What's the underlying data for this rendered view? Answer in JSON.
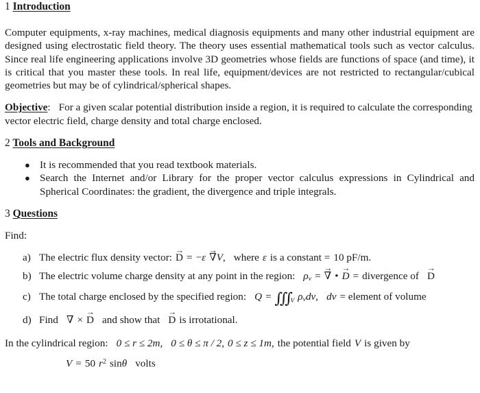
{
  "document": {
    "sections": [
      {
        "number": "1",
        "title": "Introduction"
      },
      {
        "number": "2",
        "title": "Tools and Background"
      },
      {
        "number": "3",
        "title": "Questions"
      }
    ],
    "intro_paragraph": "Computer equipments, x-ray machines, medical diagnosis equipments and many other industrial equipment are designed using electrostatic field theory.  The theory uses essential mathematical tools such as vector calculus.    Since real life engineering applications involve 3D geometries whose fields are functions of space (and time), it is critical that you master these tools.  In real life, equipment/devices are not restricted to rectangular/cubical geometries but may be of cylindrical/spherical shapes.",
    "objective": {
      "label": "Objective",
      "separator": ":",
      "text": "For a given scalar potential distribution inside a region, it is required to calculate the corresponding vector electric field, charge density and total charge enclosed."
    },
    "tools_bullets": [
      "It is recommended that you read textbook materials.",
      "Search the Internet and/or Library for the proper vector calculus expressions in Cylindrical and Spherical Coordinates: the gradient, the divergence and triple integrals."
    ],
    "find_label": "Find:",
    "questions": [
      {
        "marker": "a)",
        "lead": "The electric flux density vector:",
        "vector_symbol": "D",
        "equals": "=",
        "minus": "−",
        "epsilon": "ε",
        "nabla": "∇",
        "potential_symbol": "V",
        "comma": ",",
        "tail_pre": "where",
        "tail_mid": "is a constant =",
        "tail_value": "10 pF/m."
      },
      {
        "marker": "b)",
        "lead": "The electric volume charge density at any point in the region:",
        "rho": "ρ",
        "rho_sub": "v",
        "equals": "=",
        "nabla": "∇",
        "dot": "•",
        "vector_symbol": "D",
        "equals2": "=",
        "tail": "divergence of",
        "tail_vector": "D"
      },
      {
        "marker": "c)",
        "lead": "The total charge enclosed by the specified region:",
        "Q": "Q",
        "equals": "=",
        "integral": "∭",
        "integral_sub": "V",
        "rho": "ρ",
        "rho_sub": "v",
        "dv": "dv",
        "comma": ",",
        "tail_dv": "dv",
        "tail": "= element of volume"
      },
      {
        "marker": "d)",
        "lead": "Find",
        "nabla": "∇",
        "cross": "×",
        "vector_symbol": "D",
        "mid": "and show that",
        "vector_symbol2": "D",
        "tail": "is irrotational."
      }
    ],
    "region_statement": {
      "lead": "In the cylindrical region:",
      "r_cond": "0 ≤ r ≤ 2m,",
      "theta_cond": "0 ≤ θ ≤ π / 2,",
      "z_cond": "0 ≤ z ≤ 1m",
      "comma": ",",
      "tail_pre": "the potential field",
      "tail_symbol": "V",
      "tail_post": "is given by"
    },
    "potential_equation": {
      "symbol": "V",
      "equals": "=",
      "coefficient": "50",
      "variable": "r",
      "exponent": "2",
      "trig": "sin",
      "angle": "θ",
      "units": "volts"
    }
  }
}
